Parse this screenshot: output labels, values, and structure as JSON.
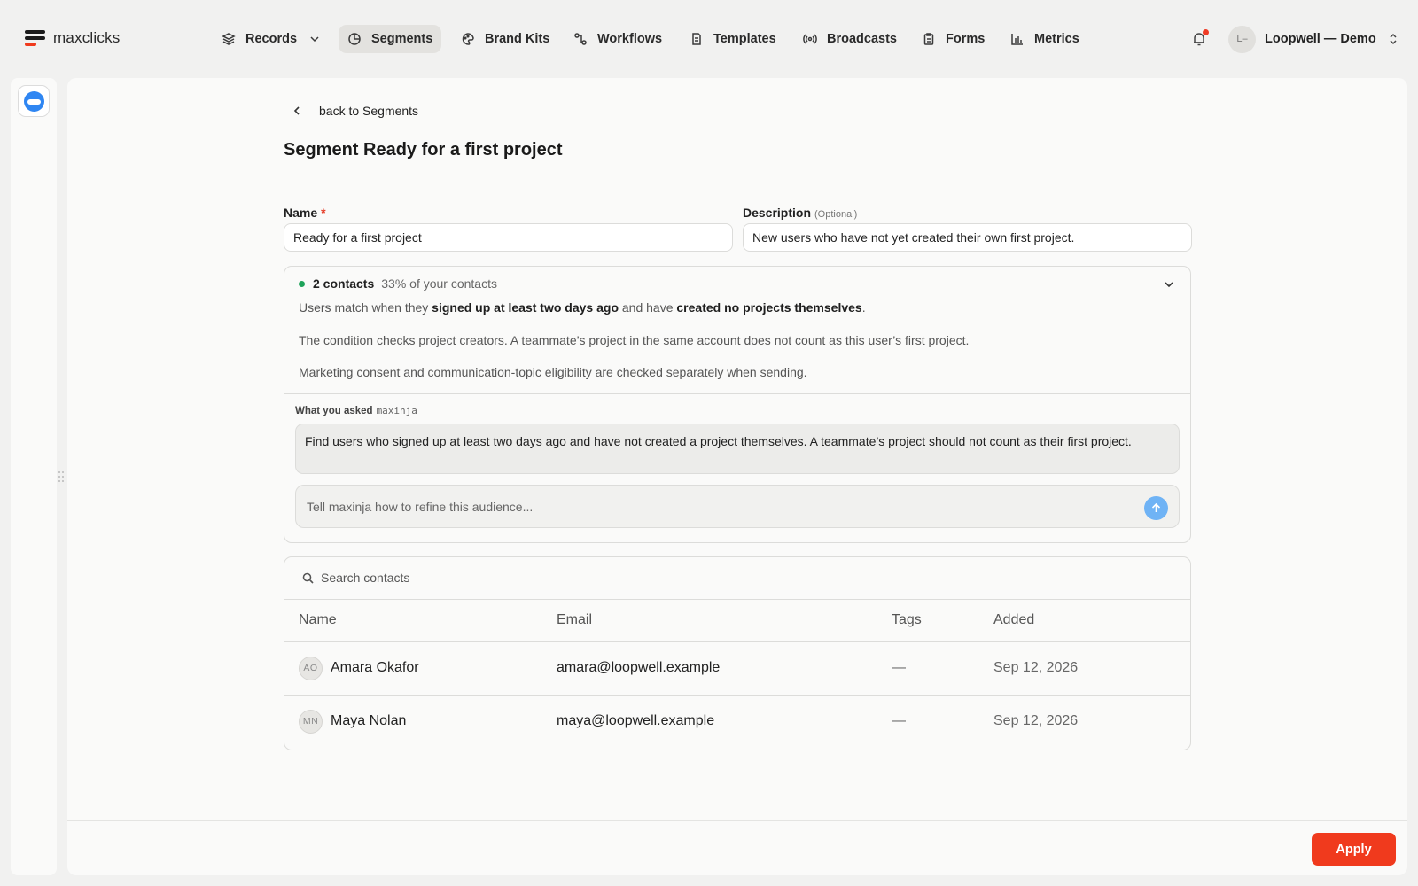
{
  "app": {
    "name": "maxclicks"
  },
  "nav": {
    "items": [
      {
        "label": "Records",
        "icon": "layers-icon"
      },
      {
        "label": "Segments",
        "icon": "pie-icon",
        "active": true
      },
      {
        "label": "Brand Kits",
        "icon": "palette-icon"
      },
      {
        "label": "Workflows",
        "icon": "workflow-icon"
      },
      {
        "label": "Templates",
        "icon": "document-icon"
      },
      {
        "label": "Broadcasts",
        "icon": "broadcast-icon"
      },
      {
        "label": "Forms",
        "icon": "clipboard-icon"
      },
      {
        "label": "Metrics",
        "icon": "bar-chart-icon"
      }
    ]
  },
  "account": {
    "initials": "L–",
    "name": "Loopwell — Demo"
  },
  "page": {
    "back_label": "back to Segments",
    "title": "Segment Ready for a first project"
  },
  "form": {
    "name_label": "Name",
    "name_required": "*",
    "name_value": "Ready for a first project",
    "description_label": "Description",
    "description_optional": "(Optional)",
    "description_value": "New users who have not yet created their own first project."
  },
  "summary": {
    "count": "2 contacts",
    "percent": "33% of your contacts",
    "rule_prefix": "Users match when they ",
    "rule_bold1": "signed up at least two days ago",
    "rule_mid": " and have ",
    "rule_bold2": "created no projects themselves",
    "rule_end": ".",
    "note1": "The condition checks project creators. A teammate’s project in the same account does not count as this user’s first project.",
    "note2": "Marketing consent and communication-topic eligibility are checked separately when sending."
  },
  "assistant": {
    "asked_label": "What you asked",
    "assistant_name": "maxinja",
    "prompt": "Find users who signed up at least two days ago and have not created a project themselves. A teammate’s project should not count as their first project.",
    "refine_placeholder": "Tell maxinja how to refine this audience..."
  },
  "contacts": {
    "search_placeholder": "Search contacts",
    "columns": [
      "Name",
      "Email",
      "Tags",
      "Added"
    ],
    "rows": [
      {
        "initials": "AO",
        "name": "Amara Okafor",
        "email": "amara@loopwell.example",
        "tags": "—",
        "added": "Sep 12, 2026"
      },
      {
        "initials": "MN",
        "name": "Maya Nolan",
        "email": "maya@loopwell.example",
        "tags": "—",
        "added": "Sep 12, 2026"
      }
    ]
  },
  "footer": {
    "apply_label": "Apply"
  },
  "colors": {
    "accent": "#f03a1d",
    "active_nav": "#e3e2df",
    "status_green": "#1ea35a",
    "send_blue": "#6fb3f5"
  }
}
